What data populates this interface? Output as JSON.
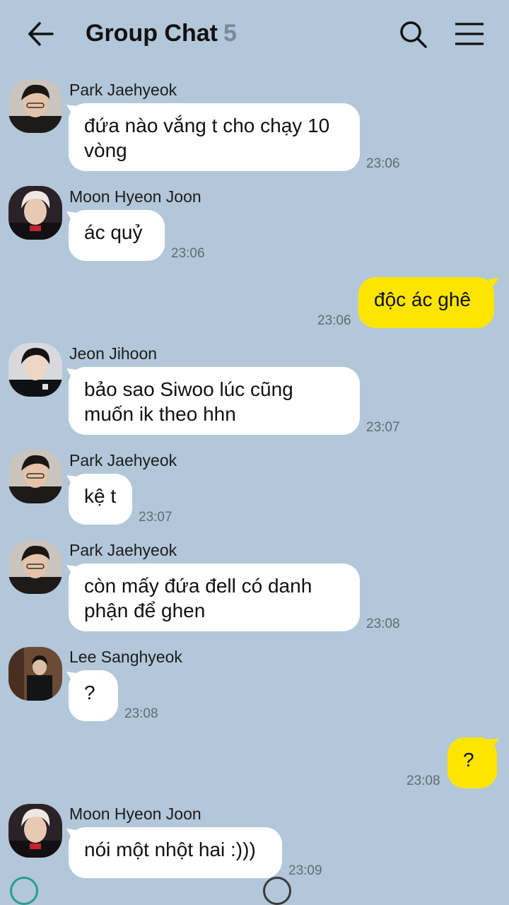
{
  "header": {
    "title": "Group Chat",
    "member_count": "5",
    "back_icon": "arrow-left-icon",
    "search_icon": "search-icon",
    "menu_icon": "menu-icon"
  },
  "messages": [
    {
      "sender": "Park Jaehyeok",
      "text": "đứa nào vắng t cho chạy 10 vòng",
      "time": "23:06",
      "outgoing": false
    },
    {
      "sender": "Moon Hyeon Joon",
      "text": "ác quỷ",
      "time": "23:06",
      "outgoing": false
    },
    {
      "sender": "",
      "text": "độc ác ghê",
      "time": "23:06",
      "outgoing": true
    },
    {
      "sender": "Jeon Jihoon",
      "text": "bảo sao Siwoo lúc cũng muốn ik theo hhn",
      "time": "23:07",
      "outgoing": false
    },
    {
      "sender": "Park Jaehyeok",
      "text": "kệ t",
      "time": "23:07",
      "outgoing": false
    },
    {
      "sender": "Park Jaehyeok",
      "text": "còn mấy đứa đell có danh phận để ghen",
      "time": "23:08",
      "outgoing": false
    },
    {
      "sender": "Lee Sanghyeok",
      "text": "?",
      "time": "23:08",
      "outgoing": false
    },
    {
      "sender": "",
      "text": "?",
      "time": "23:08",
      "outgoing": true
    },
    {
      "sender": "Moon Hyeon Joon",
      "text": "nói một nhột hai :)))",
      "time": "23:09",
      "outgoing": false
    }
  ],
  "colors": {
    "background": "#b2c7d9",
    "incoming_bubble": "#ffffff",
    "outgoing_bubble": "#fee500"
  }
}
